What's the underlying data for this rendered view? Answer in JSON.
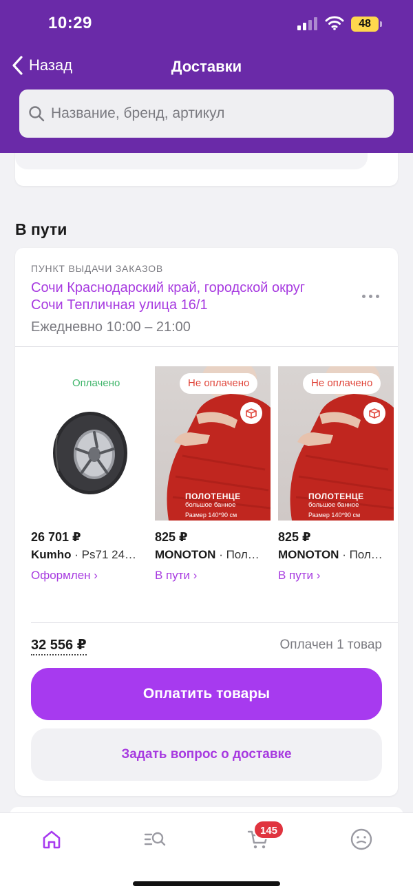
{
  "status_bar": {
    "time": "10:29",
    "battery": "48"
  },
  "nav": {
    "back_label": "Назад",
    "title": "Доставки"
  },
  "search": {
    "placeholder": "Название, бренд, артикул"
  },
  "section": {
    "title": "В пути"
  },
  "delivery": {
    "pickup_label": "ПУНКТ ВЫДАЧИ ЗАКАЗОВ",
    "address": "Сочи Краснодарский край, городской округ Сочи Тепличная улица 16/1",
    "hours": "Ежедневно 10:00 – 21:00",
    "items": [
      {
        "payment_status": "Оплачено",
        "price": "26 701 ₽",
        "brand": "Kumho",
        "name": " · Ps71 24…",
        "status": "Оформлен ›"
      },
      {
        "payment_status": "Не оплачено",
        "price": "825 ₽",
        "brand": "MONOTON",
        "name": " · Пол…",
        "status": "В пути ›",
        "image_text": [
          "ПОЛОТЕНЦЕ",
          "большое банное",
          "Размер 140*90 см"
        ]
      },
      {
        "payment_status": "Не оплачено",
        "price": "825 ₽",
        "brand": "MONOTON",
        "name": " · Пол…",
        "status": "В пути ›",
        "image_text": [
          "ПОЛОТЕНЦЕ",
          "большое банное",
          "Размер 140*90 см"
        ]
      }
    ],
    "total": "32 556 ₽",
    "paid_count": "Оплачен 1 товар",
    "pay_button": "Оплатить товары",
    "ask_button": "Задать вопрос о доставке"
  },
  "tabbar": {
    "icons": [
      "home-icon",
      "catalog-search-icon",
      "cart-icon",
      "profile-icon"
    ],
    "cart_badge": "145"
  },
  "colors": {
    "header": "#6a2aa8",
    "accent": "#a73aef",
    "paid": "#3fb56a",
    "unpaid": "#e0453a",
    "badge": "#e0343f"
  }
}
